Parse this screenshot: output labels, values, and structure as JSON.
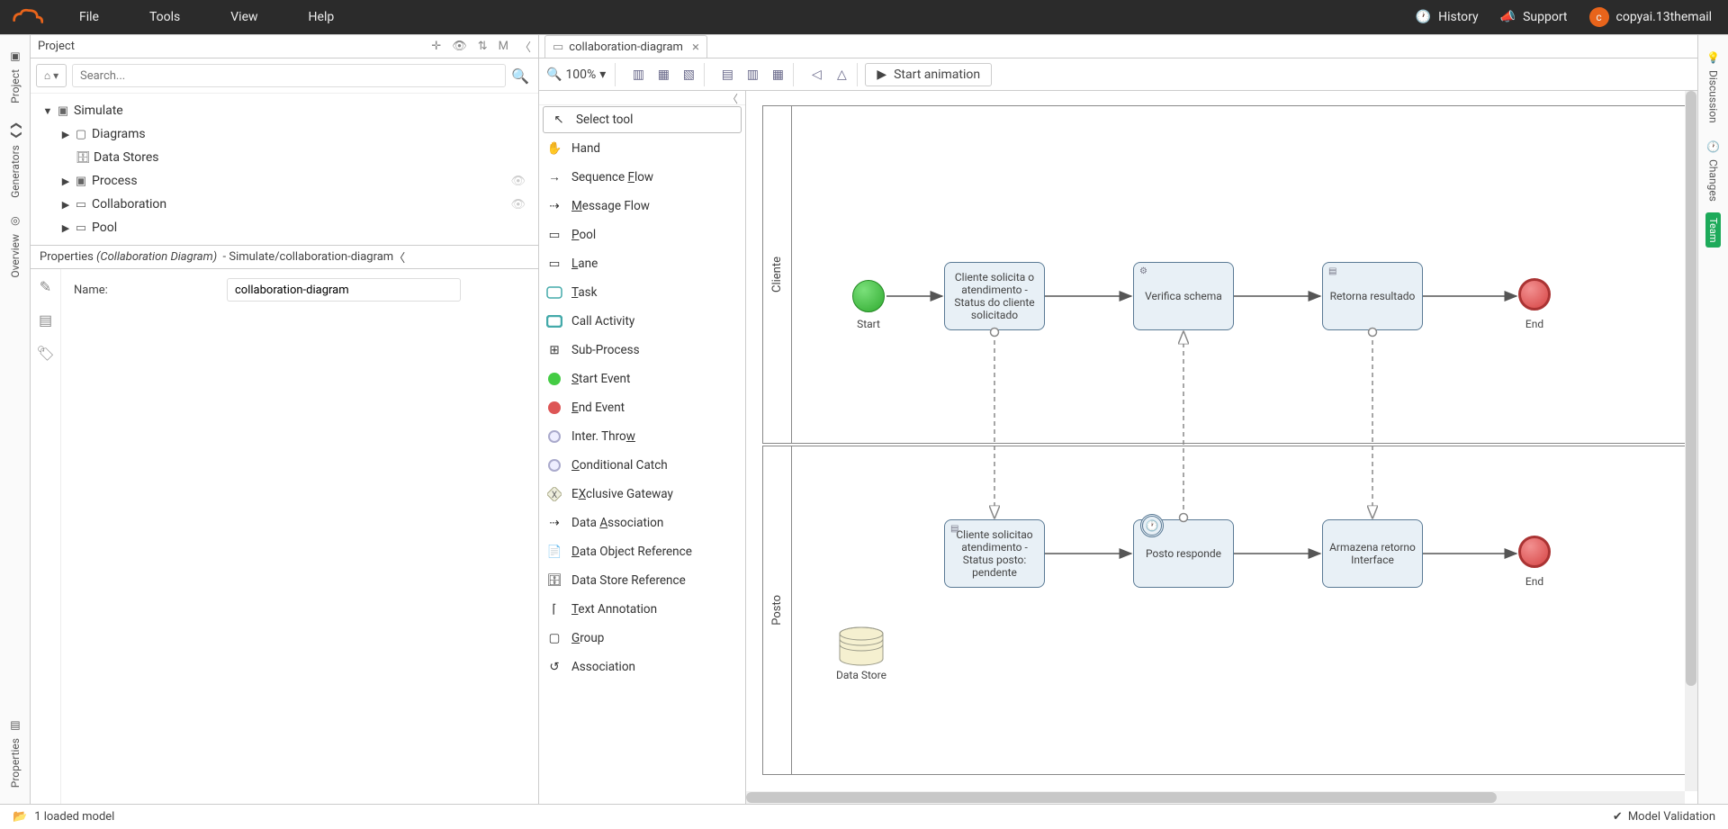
{
  "menu": {
    "file": "File",
    "tools": "Tools",
    "view": "View",
    "help": "Help"
  },
  "topRight": {
    "history": "History",
    "support": "Support",
    "user": "copyai.13themail",
    "avatarLetter": "c"
  },
  "leftRail": {
    "project": "Project",
    "generators": "Generators",
    "overview": "Overview",
    "properties": "Properties"
  },
  "projectPanel": {
    "title": "Project",
    "searchPlaceholder": "Search...",
    "mode": "M",
    "tree": {
      "root": "Simulate",
      "diagrams": "Diagrams",
      "dataStores": "Data Stores",
      "process": "Process",
      "collaboration": "Collaboration",
      "pool": "Pool"
    }
  },
  "properties": {
    "header": "Properties",
    "type": "(Collaboration Diagram)",
    "path": "- Simulate/collaboration-diagram",
    "nameLabel": "Name:",
    "nameValue": "collaboration-diagram"
  },
  "tab": {
    "label": "collaboration-diagram"
  },
  "toolbar": {
    "zoom": "100%",
    "anim": "Start animation"
  },
  "palette": {
    "selectTool": "Select tool",
    "hand": "Hand",
    "seqFlow": "Sequence Flow",
    "seqFlowU": "F",
    "msgFlow": "Message Flow",
    "msgFlowU": "M",
    "pool": "Pool",
    "poolU": "P",
    "lane": "Lane",
    "laneU": "L",
    "task": "Task",
    "taskU": "T",
    "callAct": "Call Activity",
    "subProc": "Sub-Process",
    "startEvt": "Start Event",
    "startEvtU": "S",
    "endEvt": "End Event",
    "endEvtU": "E",
    "interThrow": "Inter. Throw",
    "interThrowU": "w",
    "condCatch": "Conditional Catch",
    "condCatchU": "C",
    "exGateway": "Exclusive Gateway",
    "exGatewayU": "X",
    "dataAssoc": "Data Association",
    "dataAssocU": "A",
    "dataObjRef": "Data Object Reference",
    "dataObjRefU": "D",
    "dataStoreRef": "Data Store Reference",
    "textAnnot": "Text Annotation",
    "textAnnotU": "T",
    "group": "Group",
    "groupU": "G",
    "assoc": "Association"
  },
  "diagram": {
    "pools": {
      "cliente": "Cliente",
      "posto": "Posto"
    },
    "nodes": {
      "start1": "Start",
      "task1": "Cliente solicita o atendimento - Status do cliente solicitado",
      "task2": "Verifica schema",
      "task3": "Retorna resultado",
      "end1": "End",
      "task4": "Cliente solicitao atendimento - Status posto: pendente",
      "task5": "Posto responde",
      "task6": "Armazena retorno Interface",
      "end2": "End",
      "dataStore": "Data Store"
    }
  },
  "rightRail": {
    "discussion": "Discussion",
    "changes": "Changes",
    "team": "Team"
  },
  "status": {
    "loaded": "1 loaded model",
    "validation": "Model Validation"
  }
}
